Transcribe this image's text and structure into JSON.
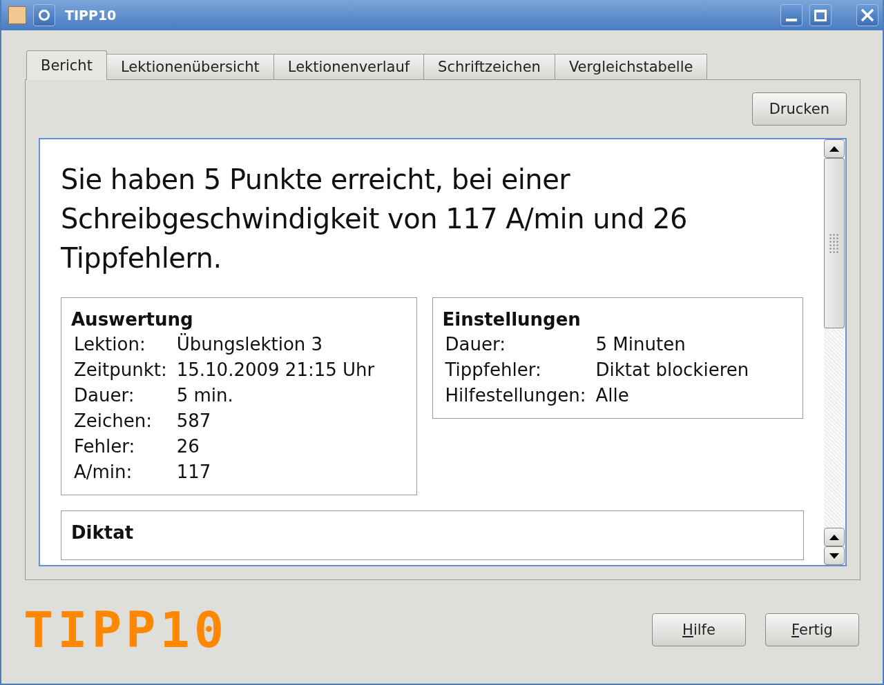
{
  "window": {
    "title": "TIPP10"
  },
  "tabs": [
    {
      "label": "Bericht",
      "selected": true
    },
    {
      "label": "Lektionenübersicht",
      "selected": false
    },
    {
      "label": "Lektionenverlauf",
      "selected": false
    },
    {
      "label": "Schriftzeichen",
      "selected": false
    },
    {
      "label": "Vergleichstabelle",
      "selected": false
    }
  ],
  "print_button": "Drucken",
  "report": {
    "headline": "Sie haben 5 Punkte erreicht, bei einer Schreibgeschwindigkeit von 117 A/min und 26 Tippfehlern.",
    "panels": [
      {
        "title": "Auswertung",
        "rows": [
          {
            "label": "Lektion:",
            "value": "Übungslektion 3"
          },
          {
            "label": "Zeitpunkt:",
            "value": "15.10.2009 21:15 Uhr"
          },
          {
            "label": "Dauer:",
            "value": "5 min."
          },
          {
            "label": "Zeichen:",
            "value": "587"
          },
          {
            "label": "Fehler:",
            "value": "26"
          },
          {
            "label": "A/min:",
            "value": "117"
          }
        ]
      },
      {
        "title": "Einstellungen",
        "rows": [
          {
            "label": "Dauer:",
            "value": "5 Minuten"
          },
          {
            "label": "Tippfehler:",
            "value": "Diktat blockieren"
          },
          {
            "label": "Hilfestellungen:",
            "value": "Alle"
          }
        ]
      }
    ],
    "next_section_title": "Diktat"
  },
  "logo": "TIPP10",
  "buttons": [
    "Hilfe",
    "Fertig"
  ]
}
